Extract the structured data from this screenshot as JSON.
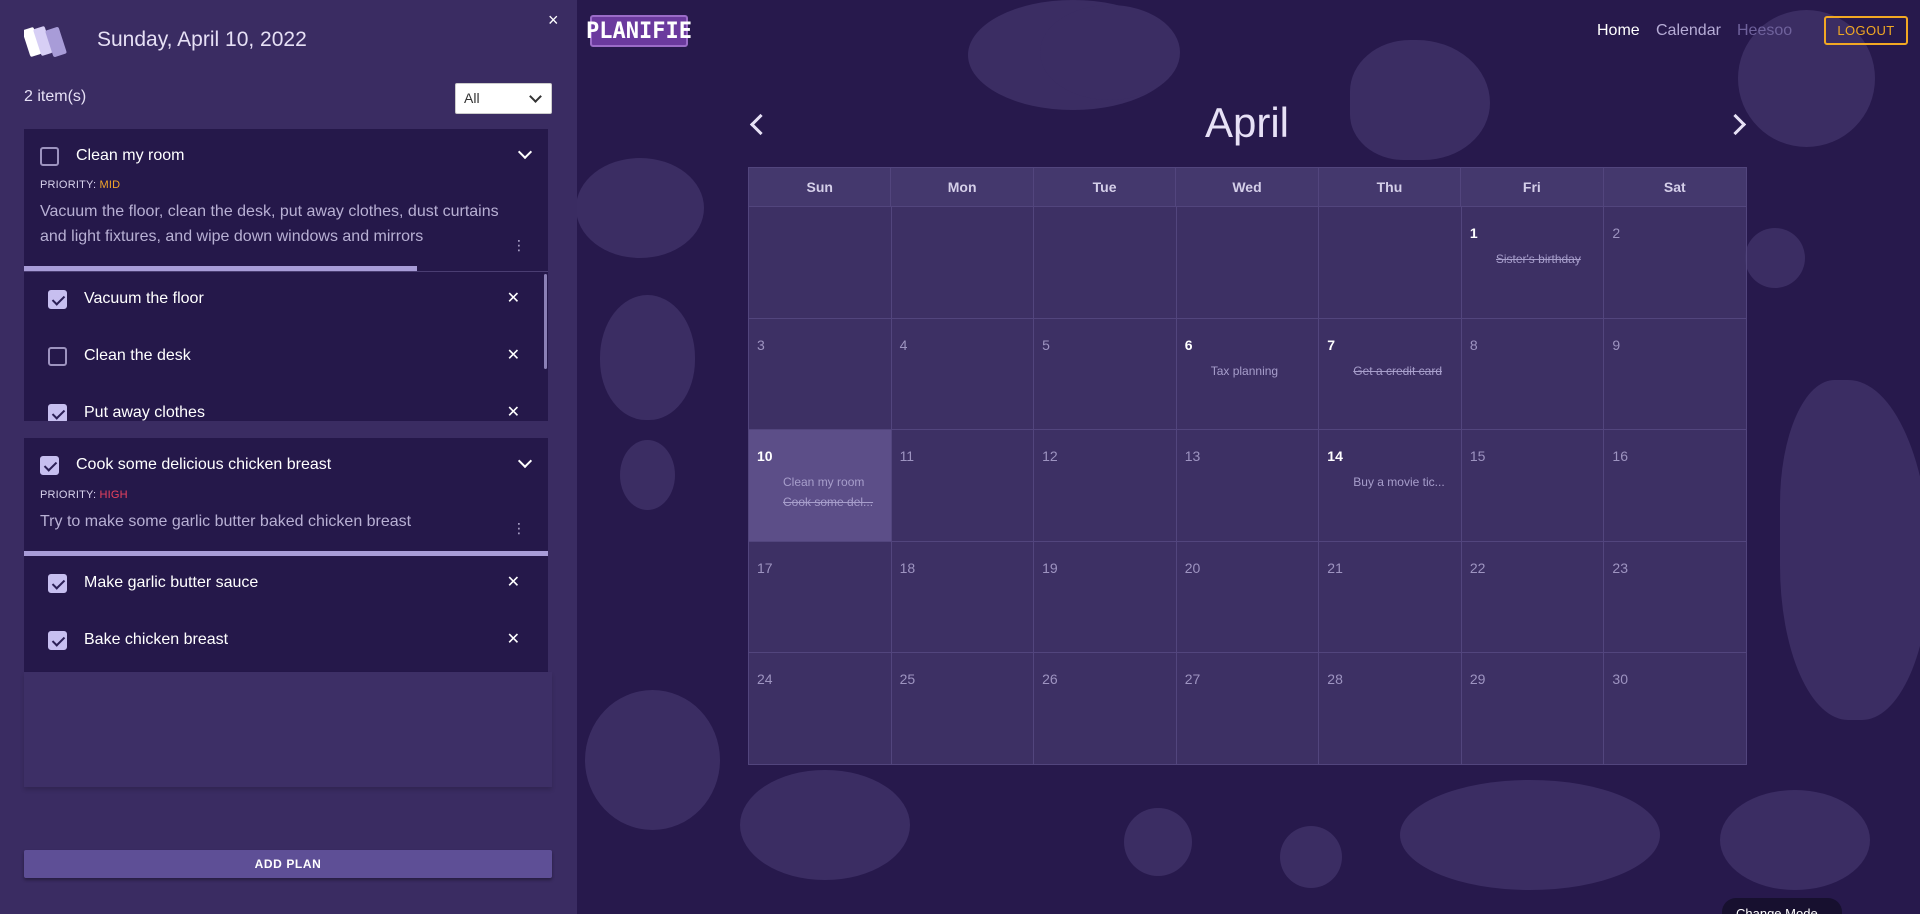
{
  "sidebar": {
    "date": "Sunday, April 10, 2022",
    "count": "2 item(s)",
    "filter": {
      "selected": "All"
    },
    "close_icon": "×",
    "add_plan": "ADD PLAN"
  },
  "plans": [
    {
      "title": "Clean my room",
      "checked": false,
      "priority_label": "PRIORITY:",
      "priority_value": "MID",
      "description": "Vacuum the floor, clean the desk, put away clothes, dust curtains and light fixtures, and wipe down windows and mirrors",
      "progress": 0.75,
      "subtasks": [
        {
          "label": "Vacuum the floor",
          "checked": true
        },
        {
          "label": "Clean the desk",
          "checked": false
        },
        {
          "label": "Put away clothes",
          "checked": true
        }
      ]
    },
    {
      "title": "Cook some delicious chicken breast",
      "checked": true,
      "priority_label": "PRIORITY:",
      "priority_value": "HIGH",
      "description": "Try to make some garlic butter baked chicken breast",
      "progress": 1.0,
      "subtasks": [
        {
          "label": "Make garlic butter sauce",
          "checked": true
        },
        {
          "label": "Bake chicken breast",
          "checked": true
        }
      ]
    }
  ],
  "header": {
    "brand": "PLANIFIE",
    "nav": {
      "home": "Home",
      "calendar": "Calendar",
      "user": "Heesoo"
    },
    "logout": "LOGOUT"
  },
  "calendar": {
    "month": "April",
    "weekdays": [
      "Sun",
      "Mon",
      "Tue",
      "Wed",
      "Thu",
      "Fri",
      "Sat"
    ],
    "leading_blanks": 5,
    "today": 10,
    "days_in_month": 30,
    "events": {
      "1": [
        {
          "text": "Sister's birthday",
          "done": true
        }
      ],
      "6": [
        {
          "text": "Tax planning",
          "done": false
        }
      ],
      "7": [
        {
          "text": "Get a credit card",
          "done": true
        }
      ],
      "10": [
        {
          "text": "Clean my room",
          "done": false
        },
        {
          "text": "Cook some del...",
          "done": true
        }
      ],
      "14": [
        {
          "text": "Buy a movie tic...",
          "done": false
        }
      ]
    }
  },
  "change_mode": "Change Mode",
  "colors": {
    "background": "#27194c",
    "sidebar": "#3a2c62",
    "card": "#25184a",
    "priority_mid": "#f4a62a",
    "priority_high": "#e8425f",
    "logout": "#f2a823"
  }
}
